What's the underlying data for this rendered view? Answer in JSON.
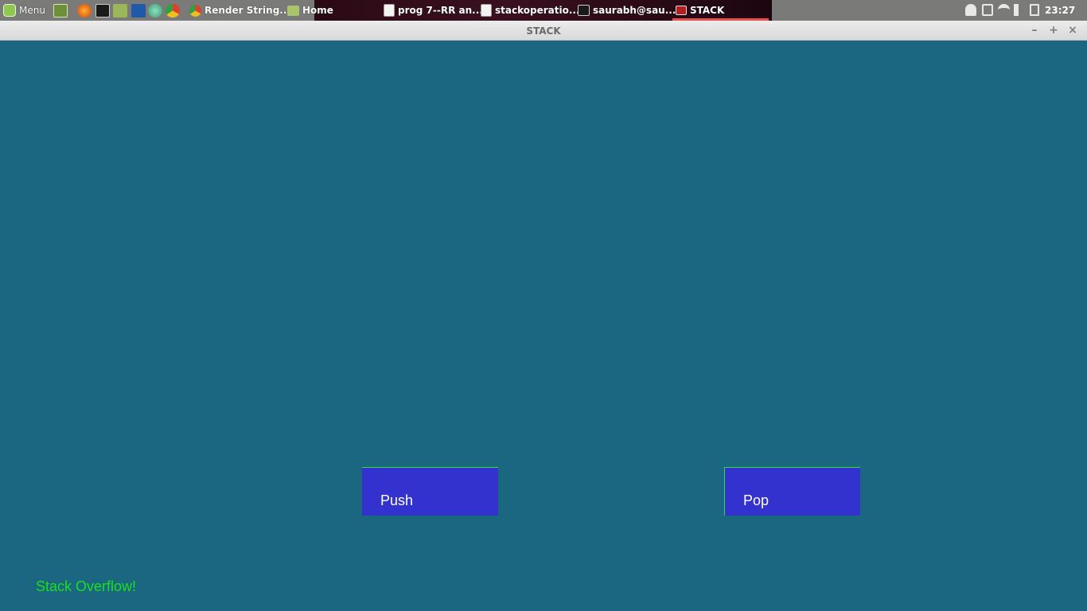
{
  "panel": {
    "menu_label": "Menu",
    "tasks": [
      {
        "label": "Render String..."
      },
      {
        "label": "Home"
      },
      {
        "label": "prog 7--RR an..."
      },
      {
        "label": "stackoperatio..."
      },
      {
        "label": "saurabh@sau..."
      },
      {
        "label": "STACK"
      }
    ],
    "clock": "23:27"
  },
  "window": {
    "title": "STACK",
    "minimize_glyph": "–",
    "maximize_glyph": "+",
    "close_glyph": "×"
  },
  "app": {
    "push_label": "Push",
    "pop_label": "Pop",
    "status": "Stack Overflow!",
    "colors": {
      "background": "#1b6680",
      "button": "#3432cf",
      "button_border": "#30e03a",
      "status_text": "#19e01c"
    }
  }
}
